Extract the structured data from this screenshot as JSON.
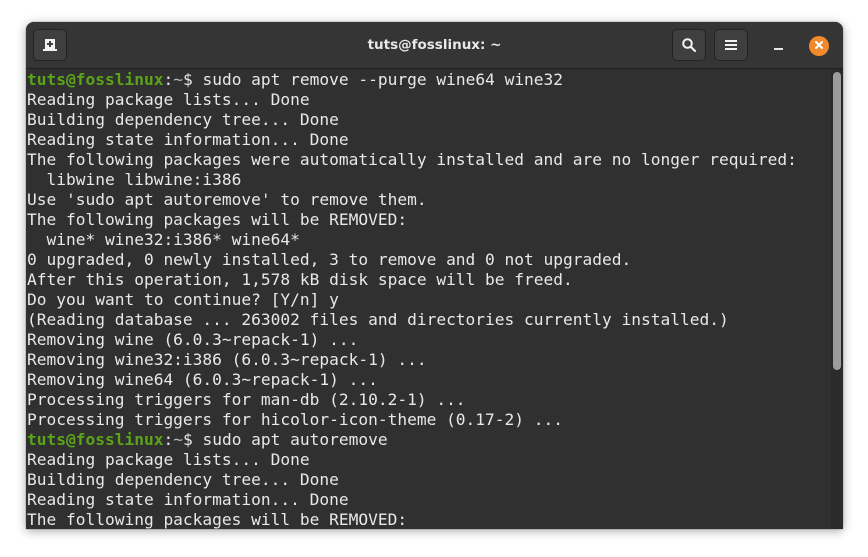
{
  "window": {
    "title": "tuts@fosslinux: ~",
    "buttons": {
      "new_tab": "new-tab-icon",
      "search": "search-icon",
      "menu": "hamburger-menu-icon",
      "minimize": "minimize-icon",
      "close": "close-icon"
    },
    "colors": {
      "prompt_user": "#5ba31a",
      "close_button": "#f08a2c",
      "background": "#303030",
      "text": "#e8e8e8"
    }
  },
  "terminal": {
    "prompt": {
      "user_host": "tuts@fosslinux",
      "separator": ":",
      "path": "~",
      "symbol": "$ "
    },
    "lines": [
      {
        "type": "command",
        "text": "sudo apt remove --purge wine64 wine32"
      },
      {
        "type": "output",
        "text": "Reading package lists... Done"
      },
      {
        "type": "output",
        "text": "Building dependency tree... Done"
      },
      {
        "type": "output",
        "text": "Reading state information... Done"
      },
      {
        "type": "output",
        "text": "The following packages were automatically installed and are no longer required:"
      },
      {
        "type": "output",
        "text": "  libwine libwine:i386"
      },
      {
        "type": "output",
        "text": "Use 'sudo apt autoremove' to remove them."
      },
      {
        "type": "output",
        "text": "The following packages will be REMOVED:"
      },
      {
        "type": "output",
        "text": "  wine* wine32:i386* wine64*"
      },
      {
        "type": "output",
        "text": "0 upgraded, 0 newly installed, 3 to remove and 0 not upgraded."
      },
      {
        "type": "output",
        "text": "After this operation, 1,578 kB disk space will be freed."
      },
      {
        "type": "output",
        "text": "Do you want to continue? [Y/n] y"
      },
      {
        "type": "output",
        "text": "(Reading database ... 263002 files and directories currently installed.)"
      },
      {
        "type": "output",
        "text": "Removing wine (6.0.3~repack-1) ..."
      },
      {
        "type": "output",
        "text": "Removing wine32:i386 (6.0.3~repack-1) ..."
      },
      {
        "type": "output",
        "text": "Removing wine64 (6.0.3~repack-1) ..."
      },
      {
        "type": "output",
        "text": "Processing triggers for man-db (2.10.2-1) ..."
      },
      {
        "type": "output",
        "text": "Processing triggers for hicolor-icon-theme (0.17-2) ..."
      },
      {
        "type": "command",
        "text": "sudo apt autoremove"
      },
      {
        "type": "output",
        "text": "Reading package lists... Done"
      },
      {
        "type": "output",
        "text": "Building dependency tree... Done"
      },
      {
        "type": "output",
        "text": "Reading state information... Done"
      },
      {
        "type": "output",
        "text": "The following packages will be REMOVED:"
      }
    ]
  }
}
